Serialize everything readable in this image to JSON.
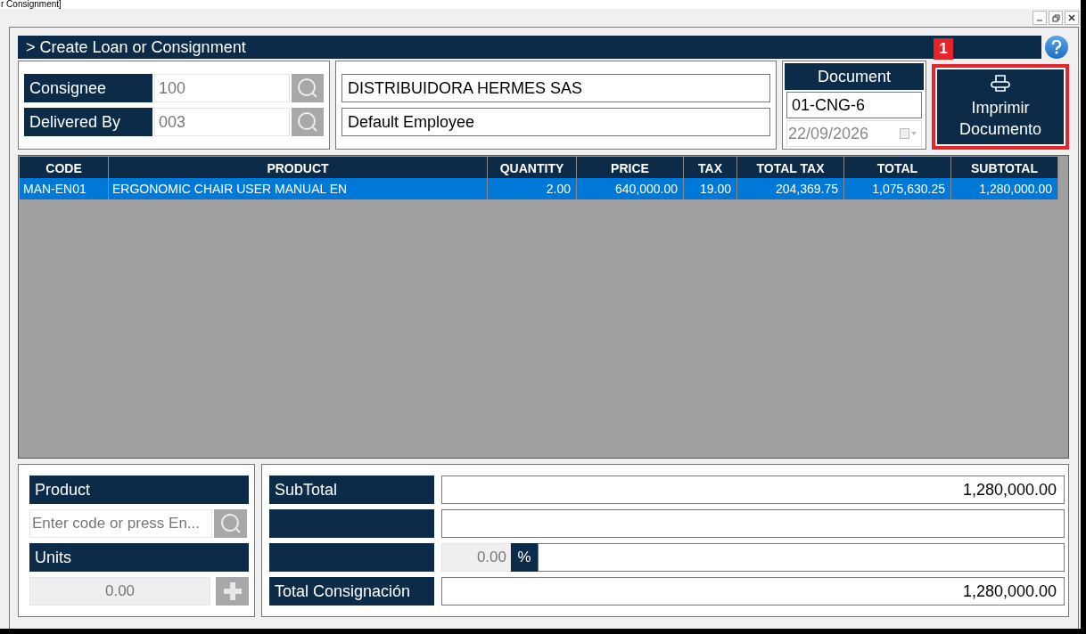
{
  "window": {
    "title": "r Consignment]"
  },
  "header": {
    "title": "> Create Loan or Consignment"
  },
  "party_fields": [
    {
      "label": "Consignee",
      "value": "100"
    },
    {
      "label": "Delivered By",
      "value": "003"
    }
  ],
  "party_names": [
    "DISTRIBUIDORA HERMES SAS",
    "Default Employee"
  ],
  "document": {
    "label": "Document",
    "number": "01-CNG-6",
    "date": "22/09/2026"
  },
  "print_button": {
    "label": "Imprimir Documento",
    "badge": "1"
  },
  "table": {
    "columns": [
      "CODE",
      "PRODUCT",
      "QUANTITY",
      "PRICE",
      "TAX",
      "TOTAL TAX",
      "TOTAL",
      "SUBTOTAL"
    ],
    "rows": [
      {
        "selected": true,
        "cells": [
          "MAN-EN01",
          "ERGONOMIC CHAIR USER MANUAL EN",
          "2.00",
          "640,000.00",
          "19.00",
          "204,369.75",
          "1,075,630.25",
          "1,280,000.00"
        ]
      }
    ]
  },
  "product_panel": {
    "label": "Product",
    "placeholder": "Enter code or press En...",
    "units_label": "Units",
    "units_value": "0.00"
  },
  "totals": [
    {
      "kind": "amount",
      "label": "SubTotal",
      "value": "1,280,000.00"
    },
    {
      "kind": "amount"
    },
    {
      "kind": "percent",
      "percent": "0.00",
      "symbol": "%"
    },
    {
      "kind": "amount",
      "label": "Total Consignación",
      "value": "1,280,000.00"
    }
  ]
}
